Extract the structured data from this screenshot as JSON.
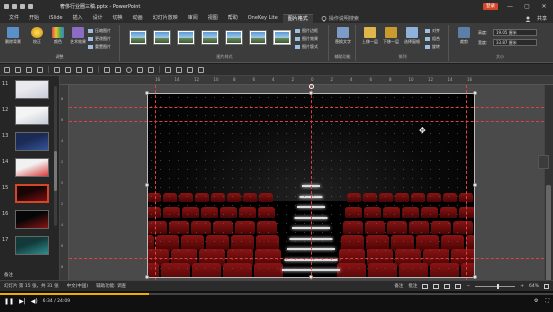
{
  "window": {
    "title": "奢侈行业圈三稿.pptx - PowerPoint",
    "login_label": "登录",
    "minimize": "—",
    "maximize": "▢",
    "close": "✕"
  },
  "menu": {
    "tabs": [
      "文件",
      "开始",
      "iSlide",
      "插入",
      "设计",
      "切换",
      "动画",
      "幻灯片放映",
      "审阅",
      "视图",
      "帮助",
      "OneKey Lite",
      "图片格式"
    ],
    "active_index": 12,
    "search_placeholder": "操作说明搜索",
    "share_label": "共享"
  },
  "ribbon": {
    "adjust": {
      "label": "调整",
      "remove_bg": "删除背景",
      "correct": "校正",
      "color": "颜色",
      "art_effect": "艺术效果",
      "compress": "压缩图片",
      "change": "更改图片",
      "reset": "重置图片"
    },
    "styles": {
      "label": "图片样式",
      "border": "图片边框",
      "effect": "图片效果",
      "layout": "图片版式"
    },
    "accessibility": {
      "label": "辅助功能",
      "alt_text": "替换文字"
    },
    "arrange": {
      "label": "排列",
      "bring_forward": "上移一层",
      "send_backward": "下移一层",
      "selection_pane": "选择窗格",
      "align": "对齐",
      "group": "组合",
      "rotate": "旋转"
    },
    "size": {
      "label": "大小",
      "crop": "裁剪",
      "height_label": "高度:",
      "height_value": "19.05 厘米",
      "width_label": "宽度:",
      "width_value": "33.87 厘米"
    }
  },
  "ruler": {
    "top_ticks": [
      "16",
      "14",
      "12",
      "10",
      "8",
      "6",
      "4",
      "2",
      "0",
      "2",
      "4",
      "6",
      "8",
      "10",
      "12",
      "14",
      "16"
    ],
    "left_ticks": [
      "8",
      "6",
      "4",
      "2",
      "0",
      "2",
      "4",
      "6",
      "8"
    ]
  },
  "slides": {
    "items": [
      {
        "num": "11",
        "colors": [
          "#e9e9ee",
          "#c9cbd8"
        ]
      },
      {
        "num": "12",
        "colors": [
          "#f4f4f4",
          "#c6ccd6"
        ]
      },
      {
        "num": "13",
        "colors": [
          "#1b2a55",
          "#34549a"
        ]
      },
      {
        "num": "14",
        "colors": [
          "#f1f1f1",
          "#d93c3c"
        ]
      },
      {
        "num": "15",
        "colors": [
          "#1a0505",
          "#7a1010"
        ]
      },
      {
        "num": "16",
        "colors": [
          "#060606",
          "#8a1414"
        ]
      },
      {
        "num": "17",
        "colors": [
          "#123a3a",
          "#2f8f8f"
        ]
      }
    ],
    "selected_index": 4,
    "footer": "备注"
  },
  "status": {
    "slide_info": "幻灯片 第 15 张，共 31 张",
    "language": "中文(中国)",
    "accessibility": "辅助功能: 调查",
    "notes": "备注",
    "comments": "批注",
    "zoom": "64%"
  },
  "player": {
    "time": "6:34 / 24:09",
    "progress_fraction": 0.27
  },
  "colors": {
    "accent": "#d24726",
    "guide": "#e04040",
    "progress": "#f2a900"
  }
}
